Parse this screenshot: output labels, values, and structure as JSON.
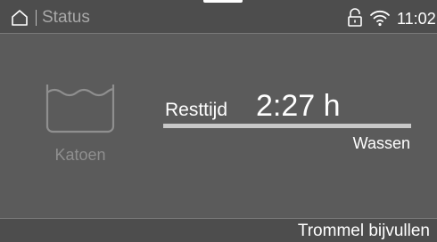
{
  "statusbar": {
    "title": "Status",
    "time": "11:02",
    "icons": [
      "home-icon",
      "lock-icon",
      "wifi-icon"
    ]
  },
  "program": {
    "icon": "wash-tub-icon",
    "name": "Katoen"
  },
  "remaining": {
    "label": "Resttijd",
    "value": "2:27 h",
    "progress": 1.0
  },
  "phase": "Wassen",
  "bottombar": {
    "action_label": "Trommel bijvullen"
  },
  "colors": {
    "background": "#5b5b5b",
    "bar": "#4d4d4d",
    "text": "#ffffff",
    "muted_text": "#8f8f8f"
  }
}
